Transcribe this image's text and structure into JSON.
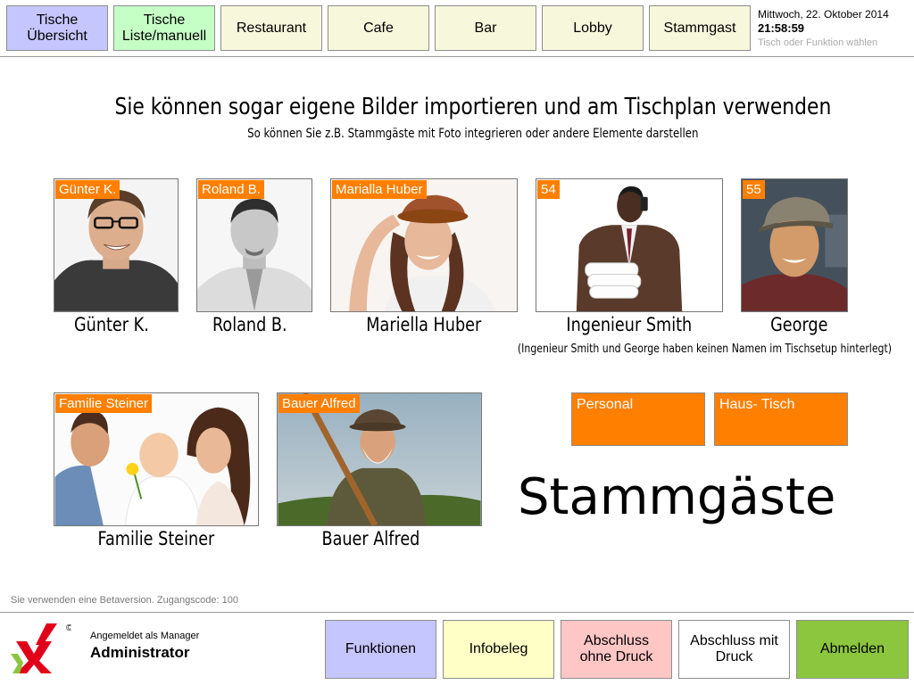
{
  "nav": {
    "tabs": [
      {
        "label": "Tische\nÜbersicht",
        "color": "#c6c6ff"
      },
      {
        "label": "Tische\nListe/manuell",
        "color": "#c6ffc6"
      },
      {
        "label": "Restaurant",
        "color": "#f7f7dc"
      },
      {
        "label": "Cafe",
        "color": "#f7f7dc"
      },
      {
        "label": "Bar",
        "color": "#f7f7dc"
      },
      {
        "label": "Lobby",
        "color": "#f7f7dc"
      },
      {
        "label": "Stammgast",
        "color": "#f7f7dc"
      }
    ]
  },
  "status": {
    "date": "Mittwoch, 22. Oktober 2014",
    "time": "21:58:59",
    "hint": "Tisch oder Funktion wählen"
  },
  "main": {
    "headline": "Sie können sogar eigene Bilder importieren und am Tischplan verwenden",
    "subline": "So können Sie z.B. Stammgäste mit Foto integrieren oder andere Elemente darstellen",
    "tiles": [
      {
        "tag": "Günter K.",
        "caption": "Günter K.",
        "icon": "portrait-guenter"
      },
      {
        "tag": "Roland B.",
        "caption": "Roland B.",
        "icon": "portrait-roland"
      },
      {
        "tag": "Marialla Huber",
        "caption": "Mariella Huber",
        "icon": "portrait-mariella"
      },
      {
        "tag": "54",
        "caption": "Ingenieur Smith",
        "icon": "portrait-smith"
      },
      {
        "tag": "55",
        "caption": "George",
        "icon": "portrait-george"
      },
      {
        "tag": "Familie Steiner",
        "caption": "Familie Steiner",
        "icon": "photo-family"
      },
      {
        "tag": "Bauer Alfred",
        "caption": "Bauer Alfred",
        "icon": "photo-farmer"
      }
    ],
    "note": "(Ingenieur Smith und George haben keinen Namen im Tischsetup hinterlegt)",
    "buttons": {
      "personal": "Personal",
      "house_table": "Haus- Tisch"
    },
    "section_title": "Stammgäste",
    "accent": "#ff7f00"
  },
  "footer": {
    "beta_note": "Sie verwenden eine Betaversion. Zugangscode: 100",
    "logged_in_label": "Angemeldet als Manager",
    "user": "Administrator",
    "buttons": [
      {
        "label": "Funktionen",
        "color": "#c6c6ff"
      },
      {
        "label": "Infobeleg",
        "color": "#ffffc6"
      },
      {
        "label": "Abschluss\nohne Druck",
        "color": "#ffc6c6"
      },
      {
        "label": "Abschluss mit\nDruck",
        "color": "#ffffff"
      },
      {
        "label": "Abmelden",
        "color": "#8cc63f"
      }
    ]
  }
}
